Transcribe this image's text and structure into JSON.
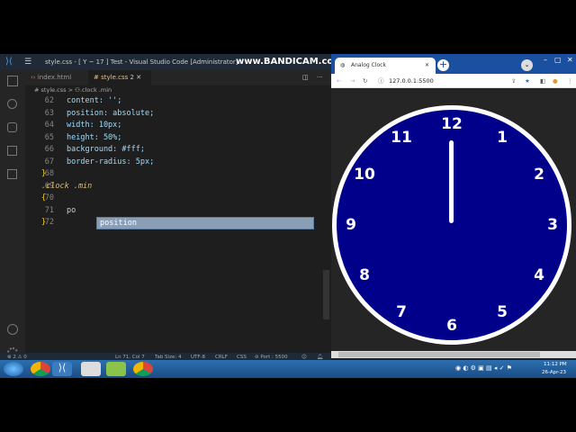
{
  "vscode": {
    "title": "style.css - [ Y ~ 17 ] Test - Visual Studio Code [Administrator]",
    "watermark": "www.BANDICAM.com",
    "tabs": [
      {
        "label": "index.html",
        "icon": "html-icon"
      },
      {
        "label": "style.css",
        "badge": "2",
        "icon": "hash-icon",
        "active": true
      }
    ],
    "breadcrumb": {
      "file": "style.css",
      "separator": ">",
      "symbol": ".clock .min"
    },
    "lines": [
      {
        "n": "62",
        "code": "content: '';"
      },
      {
        "n": "63",
        "code": "position: absolute;"
      },
      {
        "n": "64",
        "code": "width: 10px;"
      },
      {
        "n": "65",
        "code": "height: 50%;"
      },
      {
        "n": "66",
        "code": "background: #fff;"
      },
      {
        "n": "67",
        "code": "border-radius: 5px;"
      },
      {
        "n": "68",
        "code": "}"
      },
      {
        "n": "69",
        "code": ".clock .min"
      },
      {
        "n": "70",
        "code": "{"
      },
      {
        "n": "71",
        "code": "po"
      },
      {
        "n": "72",
        "code": "}"
      }
    ],
    "suggestion": "position",
    "status": {
      "errors": "2",
      "warnings": "0",
      "position": "Ln 71, Col 7",
      "tab_size": "Tab Size: 4",
      "encoding": "UTF-8",
      "eol": "CRLF",
      "language": "CSS",
      "port": "Port : 5500"
    }
  },
  "browser": {
    "tab_title": "Analog Clock",
    "url": "127.0.0.1:5500",
    "clock": {
      "numbers": [
        "12",
        "1",
        "2",
        "3",
        "4",
        "5",
        "6",
        "7",
        "8",
        "9",
        "10",
        "11"
      ],
      "face_color": "#00008b",
      "border_color": "#ffffff"
    }
  },
  "taskbar": {
    "time": "11:12 PM",
    "date": "26-Apr-23"
  }
}
